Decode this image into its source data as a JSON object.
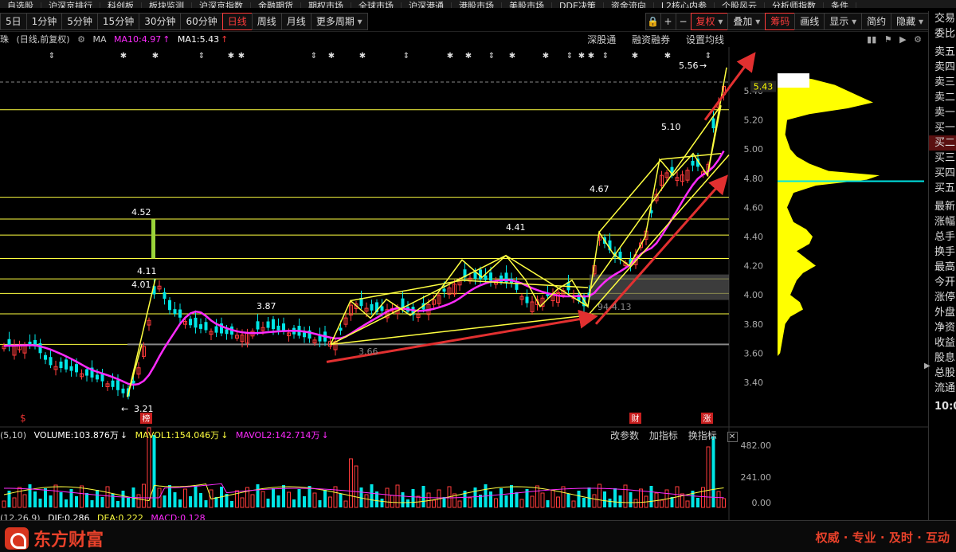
{
  "top_menu": [
    "自选股",
    "沪深京排行",
    "科创板",
    "板块监测",
    "沪深京指数",
    "金融期货",
    "期权市场",
    "全球市场",
    "沪深港通",
    "港股市场",
    "美股市场",
    "DDE决策",
    "资金流向",
    "L2核心内参",
    "个股风云",
    "分析师指数",
    "条件"
  ],
  "period_tabs": [
    "5日",
    "1分钟",
    "5分钟",
    "15分钟",
    "30分钟",
    "60分钟",
    "日线",
    "周线",
    "月线",
    "更多周期"
  ],
  "active_period": "日线",
  "toolbar_right": {
    "fuquan": "复权",
    "overlay": "叠加",
    "chips": "筹码",
    "draw": "画线",
    "display": "显示",
    "simple": "简约",
    "hide": "隐藏",
    "plus": "+",
    "minus": "−"
  },
  "legend": {
    "name": "珠",
    "mode": "(日线,前复权)",
    "gear": "⚙",
    "ma_label": "MA",
    "ma10": "MA10:4.97",
    "ma10_arrow": "↑",
    "ma1": "MA1:5.43",
    "ma1_arrow": "↑"
  },
  "chart_links": [
    "深股通",
    "融资融券",
    "设置均线"
  ],
  "price_axis": [
    "5.40",
    "5.20",
    "5.00",
    "4.80",
    "4.60",
    "4.40",
    "4.20",
    "4.00",
    "3.80",
    "3.60",
    "3.40"
  ],
  "current_price": "5.43",
  "annotations": {
    "high_556": "5.56",
    "l510": "5.10",
    "l467": "4.67",
    "l452": "4.52",
    "l441": "4.41",
    "l411": "4.11",
    "l401": "4.01",
    "l387": "3.87",
    "l366": "3.66",
    "l321": "3.21",
    "l413": "94-4.13"
  },
  "badges": {
    "bang": "榜",
    "cai": "财",
    "zhang": "涨",
    "dollar": "$"
  },
  "volume": {
    "label": "(5,10)",
    "vol": "VOLUME:103.876万",
    "vol_arrow": "↓",
    "mavol1": "MAVOL1:154.046万",
    "mavol1_arrow": "↓",
    "mavol2": "MAVOL2:142.714万",
    "mavol2_arrow": "↓",
    "links": [
      "改参数",
      "加指标",
      "换指标"
    ],
    "close": "✕",
    "axis": [
      "482.00",
      "241.00",
      "0.00"
    ]
  },
  "macd": {
    "label": "(12,26,9)",
    "dif": "DIF:0.286",
    "dea": "DEA:0.222",
    "macd": "MACD:0.128"
  },
  "side_panel": [
    "交易",
    "委比",
    "卖五",
    "卖四",
    "卖三",
    "卖二",
    "卖一",
    "买一",
    "买二",
    "买三",
    "买四",
    "买五",
    "最新",
    "涨幅",
    "总手",
    "换手",
    "最高",
    "今开",
    "涨停",
    "外盘",
    "净资",
    "收益",
    "股息",
    "总股",
    "流通",
    "10:0"
  ],
  "brand": {
    "name": "东方财富",
    "slogan": "权威 · 专业 · 及时 · 互动"
  },
  "colors": {
    "up": "#ff3b3b",
    "down": "#00e5e5",
    "ma10": "#ff2bff",
    "ma1": "#ffffff",
    "draw": "#ffff40",
    "arrow": "#e23030",
    "profile": "#ffff00",
    "brand": "#e8412a"
  }
}
